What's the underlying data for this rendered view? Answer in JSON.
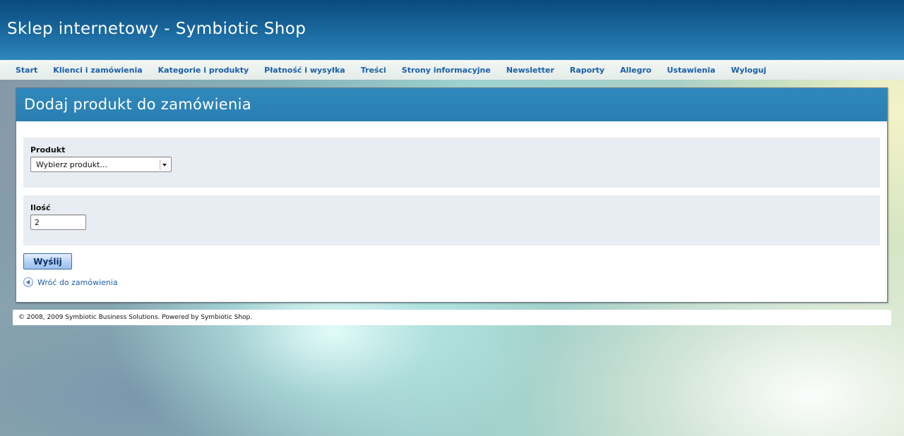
{
  "header": {
    "title": "Sklep internetowy - Symbiotic Shop"
  },
  "nav": {
    "items": [
      {
        "label": "Start"
      },
      {
        "label": "Klienci i zamówienia"
      },
      {
        "label": "Kategorie i produkty"
      },
      {
        "label": "Płatność i wysyłka"
      },
      {
        "label": "Treści"
      },
      {
        "label": "Strony informacyjne"
      },
      {
        "label": "Newsletter"
      },
      {
        "label": "Raporty"
      },
      {
        "label": "Allegro"
      },
      {
        "label": "Ustawienia"
      },
      {
        "label": "Wyloguj"
      }
    ]
  },
  "panel": {
    "title": "Dodaj produkt do zamówienia",
    "product": {
      "label": "Produkt",
      "selected": "Wybierz produkt..."
    },
    "quantity": {
      "label": "Ilość",
      "value": "2"
    },
    "submit_label": "Wyślij",
    "back_link": "Wróć do zamówienia"
  },
  "footer": {
    "text": "© 2008, 2009 Symbiotic Business Solutions. Powered by Symbiotic Shop."
  },
  "colors": {
    "header_blue": "#0b4a7d",
    "panel_header_blue": "#2f88bb",
    "link_blue": "#1a5fa8",
    "field_background": "#e8ecf3"
  },
  "icons": {
    "back_link_icon": "back-arrow-circle-icon",
    "select_arrow_icon": "chevron-down-icon"
  }
}
